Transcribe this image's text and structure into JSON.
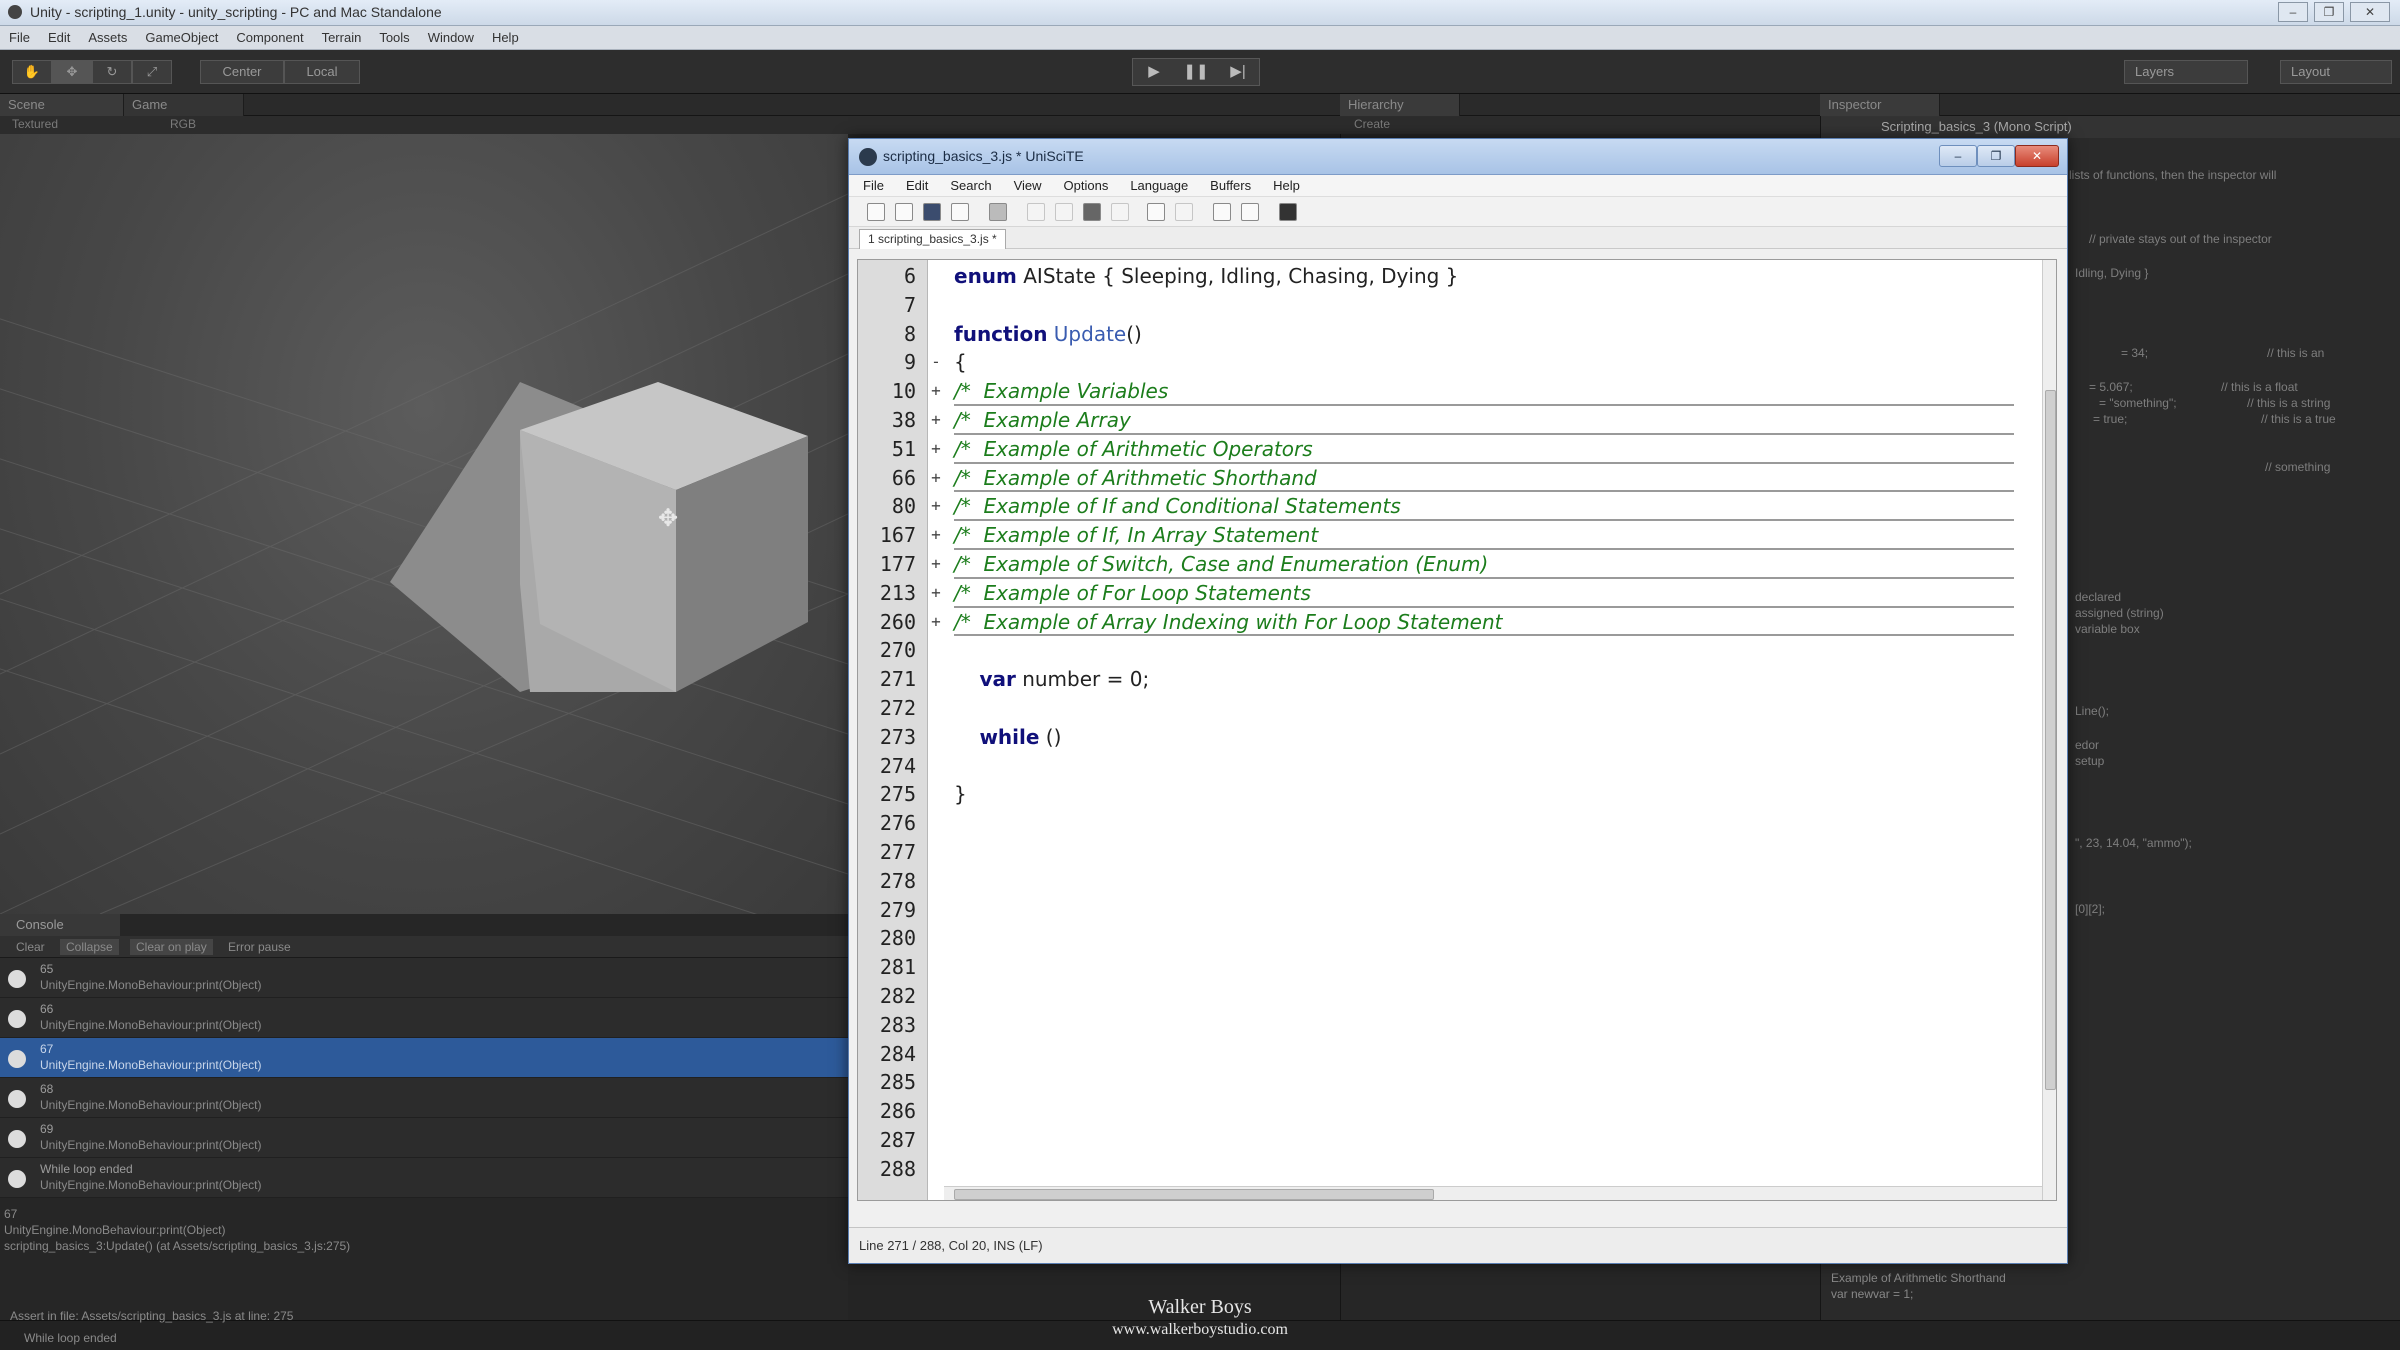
{
  "unity": {
    "title": "Unity - scripting_1.unity - unity_scripting - PC and Mac Standalone",
    "menu": [
      "File",
      "Edit",
      "Assets",
      "GameObject",
      "Component",
      "Terrain",
      "Tools",
      "Window",
      "Help"
    ],
    "toolbar": {
      "pivot": "Center",
      "space": "Local",
      "layers": "Layers",
      "layout": "Layout"
    },
    "tabs": {
      "scene": "Scene",
      "game": "Game",
      "hierarchy": "Hierarchy",
      "inspector": "Inspector"
    },
    "scene_sub": {
      "shading": "Textured",
      "mode": "RGB",
      "create": "Create"
    },
    "inspector_header": "Scripting_basics_3 (Mono Script)",
    "inspector_snippets": [
      "lists of functions, then the inspector will",
      "// private stays out of the inspector",
      "Idling, Dying }",
      "= 34;",
      "// this is an",
      "= 5.067;",
      "// this is a float",
      "= \"something\";",
      "// this is a string",
      "= true;",
      "// this is a true",
      "// something",
      "declared",
      "assigned (string)",
      "variable box",
      "Line();",
      "edor",
      "setup",
      "\", 23, 14.04, \"ammo\");",
      "[0][2];",
      "Example of Arithmetic Shorthand",
      "var newvar = 1;"
    ]
  },
  "console": {
    "tab": "Console",
    "buttons": [
      "Clear",
      "Collapse",
      "Clear on play",
      "Error pause"
    ],
    "rows": [
      {
        "l1": "65",
        "l2": "UnityEngine.MonoBehaviour:print(Object)"
      },
      {
        "l1": "66",
        "l2": "UnityEngine.MonoBehaviour:print(Object)"
      },
      {
        "l1": "67",
        "l2": "UnityEngine.MonoBehaviour:print(Object)"
      },
      {
        "l1": "68",
        "l2": "UnityEngine.MonoBehaviour:print(Object)"
      },
      {
        "l1": "69",
        "l2": "UnityEngine.MonoBehaviour:print(Object)"
      },
      {
        "l1": "While loop ended",
        "l2": "UnityEngine.MonoBehaviour:print(Object)"
      }
    ],
    "detail": [
      "67",
      "UnityEngine.MonoBehaviour:print(Object)",
      "scripting_basics_3:Update() (at Assets/scripting_basics_3.js:275)"
    ]
  },
  "status": {
    "assert": "Assert in file: Assets/scripting_basics_3.js at line: 275",
    "last": "While loop ended"
  },
  "watermark": {
    "line1": "Walker Boys",
    "line2": "www.walkerboystudio.com"
  },
  "editor": {
    "title": "scripting_basics_3.js * UniSciTE",
    "menu": [
      "File",
      "Edit",
      "Search",
      "View",
      "Options",
      "Language",
      "Buffers",
      "Help"
    ],
    "tab": "1 scripting_basics_3.js *",
    "status": "Line 271 / 288, Col 20, INS (LF)",
    "lines": [
      {
        "n": "6",
        "f": "",
        "code": "enum AIState { Sleeping, Idling, Chasing, Dying }",
        "fold": false
      },
      {
        "n": "7",
        "f": "",
        "code": "",
        "fold": false
      },
      {
        "n": "8",
        "f": "",
        "code": "function Update()",
        "fold": false
      },
      {
        "n": "9",
        "f": "-",
        "code": "{",
        "fold": false
      },
      {
        "n": "10",
        "f": "+",
        "code": "/*  Example Variables",
        "fold": true
      },
      {
        "n": "38",
        "f": "+",
        "code": "/*  Example Array",
        "fold": true
      },
      {
        "n": "51",
        "f": "+",
        "code": "/*  Example of Arithmetic Operators",
        "fold": true
      },
      {
        "n": "66",
        "f": "+",
        "code": "/*  Example of Arithmetic Shorthand",
        "fold": true
      },
      {
        "n": "80",
        "f": "+",
        "code": "/*  Example of If and Conditional Statements",
        "fold": true
      },
      {
        "n": "167",
        "f": "+",
        "code": "/*  Example of If, In Array Statement",
        "fold": true
      },
      {
        "n": "177",
        "f": "+",
        "code": "/*  Example of Switch, Case and Enumeration (Enum)",
        "fold": true
      },
      {
        "n": "213",
        "f": "+",
        "code": "/*  Example of For Loop Statements",
        "fold": true
      },
      {
        "n": "260",
        "f": "+",
        "code": "/*  Example of Array Indexing with For Loop Statement",
        "fold": true
      },
      {
        "n": "270",
        "f": "",
        "code": "",
        "fold": false
      },
      {
        "n": "271",
        "f": "",
        "code": "    var number = 0;",
        "fold": false
      },
      {
        "n": "272",
        "f": "",
        "code": "",
        "fold": false
      },
      {
        "n": "273",
        "f": "",
        "code": "    while ()",
        "fold": false
      },
      {
        "n": "274",
        "f": "",
        "code": "",
        "fold": false
      },
      {
        "n": "275",
        "f": "",
        "code": "}",
        "fold": false
      },
      {
        "n": "276",
        "f": "",
        "code": "",
        "fold": false
      },
      {
        "n": "277",
        "f": "",
        "code": "",
        "fold": false
      },
      {
        "n": "278",
        "f": "",
        "code": "",
        "fold": false
      },
      {
        "n": "279",
        "f": "",
        "code": "",
        "fold": false
      },
      {
        "n": "280",
        "f": "",
        "code": "",
        "fold": false
      },
      {
        "n": "281",
        "f": "",
        "code": "",
        "fold": false
      },
      {
        "n": "282",
        "f": "",
        "code": "",
        "fold": false
      },
      {
        "n": "283",
        "f": "",
        "code": "",
        "fold": false
      },
      {
        "n": "284",
        "f": "",
        "code": "",
        "fold": false
      },
      {
        "n": "285",
        "f": "",
        "code": "",
        "fold": false
      },
      {
        "n": "286",
        "f": "",
        "code": "",
        "fold": false
      },
      {
        "n": "287",
        "f": "",
        "code": "",
        "fold": false
      },
      {
        "n": "288",
        "f": "",
        "code": "",
        "fold": false
      }
    ],
    "keywords": [
      "enum",
      "function",
      "var",
      "while"
    ],
    "functions": [
      "Update"
    ]
  },
  "colors": {
    "keyword": "#10107a",
    "comment": "#1c7d1c",
    "function": "#3a5cb0",
    "selection": "#2d5a9a"
  }
}
